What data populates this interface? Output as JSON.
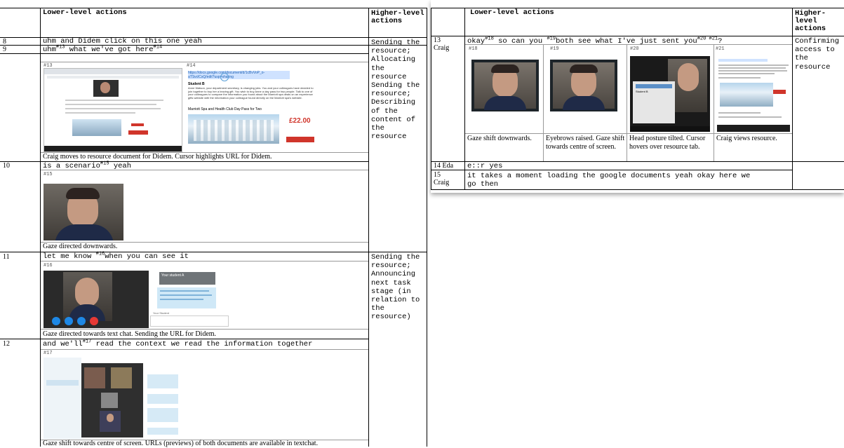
{
  "left": {
    "headers": {
      "col2": "Lower-level actions",
      "col3": "Higher-level actions"
    },
    "rows": [
      {
        "num": "8",
        "utterance": "uhm and Didem click on this one yeah"
      },
      {
        "num": "9",
        "utterance_a": "uhm",
        "sup_a": "#13",
        "utterance_b": " what we've got here",
        "sup_b": "#14",
        "fig_a": "#13",
        "fig_b": "#14",
        "doc_url": "https://docs.google.com/document/d/1cBvVoP_o-aTSvclCsQ/edit?usp=sharing",
        "doc_title": "Student B",
        "doc_text": "Anne Watson, your department secretary, is changing jobs. You and your colleagues have decided to join together to buy her a leaving gift. You wish to buy Anne a day pass for two people. Talk to one of your colleagues to compare the information you found about the Marriott spa deals on an experience gifts website with the information your colleague found directly on the Marriott spa's website.",
        "doc_heading": "Marriott Spa and Health Club Day Pass for Two",
        "price": "£22.00",
        "caption": "Craig moves to resource document for Didem.  Cursor highlights URL for Didem."
      },
      {
        "num": "10",
        "utterance": "is a scenario",
        "sup": "#15",
        "utterance_after": " yeah",
        "fig": "#15",
        "caption": "Gaze directed downwards."
      },
      {
        "num": "11",
        "utterance": "let me know ",
        "sup": "#16",
        "utterance_after": "when you can see it",
        "fig": "#16",
        "chat_header": "Your student A",
        "chat_user": "Your Student",
        "caption": "Gaze directed towards text chat. Sending the URL for Didem."
      },
      {
        "num": "12",
        "utterance": "and we'll",
        "sup": "#17",
        "utterance_after": " read the context we read the information together",
        "fig": "#17",
        "caption": "Gaze shift towards centre of screen. URLs (previews) of both documents are available in textchat."
      }
    ],
    "higher_1": [
      "Sending the",
      "resource;",
      "Allocating",
      "the",
      "resource",
      "Sending the",
      "resource;",
      "Describing",
      "of the",
      "content of",
      "the",
      "resource"
    ],
    "higher_2": [
      "Sending the",
      "resource;",
      "Announcing",
      "next task",
      "stage (in",
      "relation to",
      "the",
      "resource)"
    ]
  },
  "right": {
    "headers": {
      "col2": "Lower-level actions",
      "col3": "Higher-level actions"
    },
    "row13": {
      "num": "13",
      "speaker": "Craig",
      "u1": "okay",
      "s1": "#18",
      "u2": " so can you ",
      "s2": "#19",
      "u3": "both see what I've just sent you",
      "s3": "#20 #21",
      "u4": "?",
      "figs": [
        "#18",
        "#19",
        "#20",
        "#21"
      ],
      "shot_title": "Student B",
      "captions": [
        "Gaze shift downwards.",
        "Eyebrows raised. Gaze shift towards centre of screen.",
        "Head posture tilted. Cursor hovers over resource tab.",
        "Craig views resource."
      ]
    },
    "higher_13": [
      "Confirming",
      "access to",
      "the",
      "resource"
    ],
    "row14": {
      "num": "14 Eda",
      "utterance": "e::r yes"
    },
    "row15": {
      "num": "15",
      "speaker": "Craig",
      "utterance": "it takes a moment loading the google documents yeah okay here we",
      "utterance2": "go then"
    }
  }
}
